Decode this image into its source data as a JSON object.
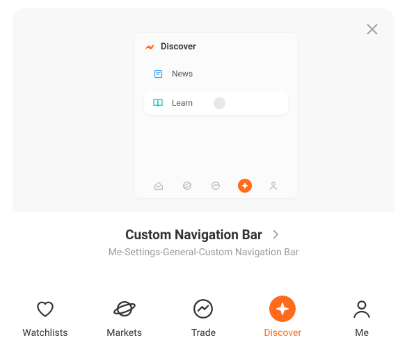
{
  "card": {
    "preview": {
      "title": "Discover",
      "items": [
        {
          "label": "News"
        },
        {
          "label": "Learn"
        }
      ]
    },
    "bottom": {
      "title": "Custom Navigation Bar",
      "subtitle": "Me-Settings-General-Custom Navigation Bar"
    }
  },
  "nav": {
    "items": [
      {
        "label": "Watchlists"
      },
      {
        "label": "Markets"
      },
      {
        "label": "Trade"
      },
      {
        "label": "Discover"
      },
      {
        "label": "Me"
      }
    ]
  }
}
